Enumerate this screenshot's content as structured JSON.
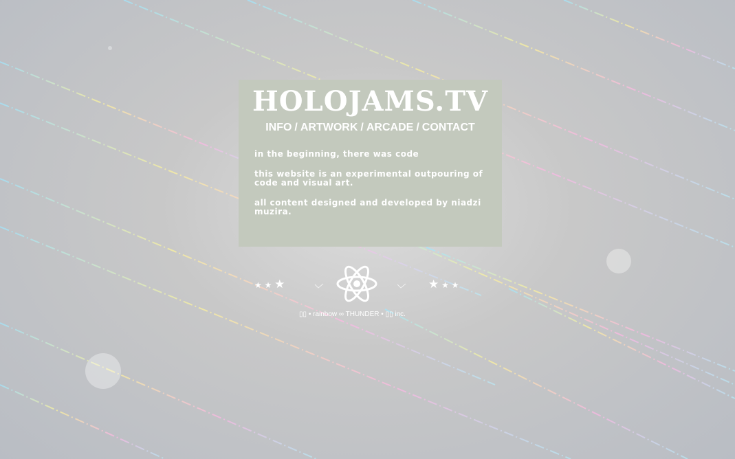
{
  "site": {
    "title": "HOLOJAMS.TV"
  },
  "nav": {
    "items": [
      "INFO",
      "ARTWORK",
      "ARCADE",
      "CONTACT"
    ],
    "separator": "/"
  },
  "content": {
    "paragraphs": [
      "in the beginning, there was code",
      "this website is an experimental outpouring of code and visual art.",
      "all content designed and developed by niadzi muzira."
    ]
  },
  "footer": {
    "credit": "▯▯ • rainbow ∞ THUNDER • ▯▯ inc.",
    "emblem_icon": "atom-icon"
  },
  "colors": {
    "card_bg": "#c3c9bd",
    "text": "#ffffff",
    "background": "#c8c8c8"
  }
}
